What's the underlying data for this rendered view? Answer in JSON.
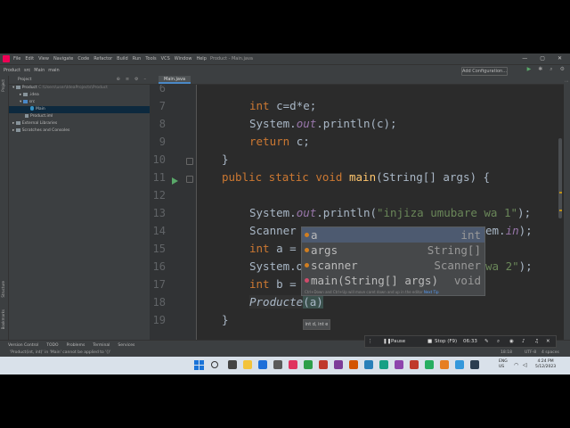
{
  "window": {
    "title": "Product - Main.java",
    "menu": [
      "File",
      "Edit",
      "View",
      "Navigate",
      "Code",
      "Refactor",
      "Build",
      "Run",
      "Tools",
      "VCS",
      "Window",
      "Help"
    ],
    "controls": [
      "—",
      "▢",
      "✕"
    ]
  },
  "navbar": {
    "breadcrumbs": [
      "Product",
      "src",
      "Main",
      "main"
    ],
    "add_config": "Add Configuration..."
  },
  "left_tabs": [
    "Project",
    "Structure",
    "Bookmarks"
  ],
  "project": {
    "header": "Project",
    "tree": [
      {
        "label": "Product",
        "extra": "C:\\Users\\user\\IdeaProjects\\Product"
      },
      {
        "label": ".idea",
        "extra": ""
      },
      {
        "label": "src",
        "extra": ""
      },
      {
        "label": "Main",
        "extra": ""
      },
      {
        "label": "Product.iml",
        "extra": ""
      },
      {
        "label": "External Libraries",
        "extra": ""
      },
      {
        "label": "Scratches and Consoles",
        "extra": ""
      }
    ]
  },
  "editor_tab": "Main.java",
  "line_numbers": [
    "6",
    "7",
    "8",
    "9",
    "10",
    "11",
    "12",
    "13",
    "14",
    "15",
    "16",
    "17",
    "18",
    "19"
  ],
  "code": {
    "l7_kw": "int ",
    "l7_rest": "c=d*e;",
    "l8_a": "System.",
    "l8_out": "out",
    "l8_b": ".println(c);",
    "l9_kw": "return ",
    "l9_rest": "c;",
    "l10": "}",
    "l11_kw": "public static void ",
    "l11_fn": "main",
    "l11_rest": "(String[] args) {",
    "l13_a": "System.",
    "l13_out": "out",
    "l13_b": ".println(",
    "l13_str": "\"injiza umubare wa 1\"",
    "l13_c": ");",
    "l14_a": "Scanner",
    "l14_b": "em.",
    "l14_in": "in",
    "l14_c": ");",
    "l15_kw": "int ",
    "l15_rest": "a =",
    "l16_a": "System.o",
    "l16_str": "wa 2\"",
    "l16_c": ");",
    "l17_kw": "int ",
    "l17_rest": "b =",
    "l18_a": "Producte",
    "l18_b": "(a)",
    "l19": "}"
  },
  "completion": {
    "items": [
      {
        "name": "a",
        "type": "int"
      },
      {
        "name": "args",
        "type": "String[]"
      },
      {
        "name": "scanner",
        "type": "Scanner"
      },
      {
        "name": "main(String[] args)",
        "type": "void"
      }
    ],
    "hint_text": "Ctrl+Down and Ctrl+Up will move caret down and up in the editor",
    "hint_link": "Next Tip"
  },
  "param_tooltip": "int d, int e",
  "toolwindows": [
    "Version Control",
    "TODO",
    "Problems",
    "Terminal",
    "Services"
  ],
  "status": {
    "message": "'Product(int, int)' in 'Main' cannot be applied to '()'",
    "position": "18:18",
    "encoding": "UTF-8",
    "indent": "4 spaces"
  },
  "recorder": {
    "pause": "Pause",
    "stop": "Stop (F9)",
    "time": "06:33"
  },
  "taskbar": {
    "lang": "ENG\nUS",
    "time": "4:24 PM",
    "date": "5/12/2023"
  }
}
